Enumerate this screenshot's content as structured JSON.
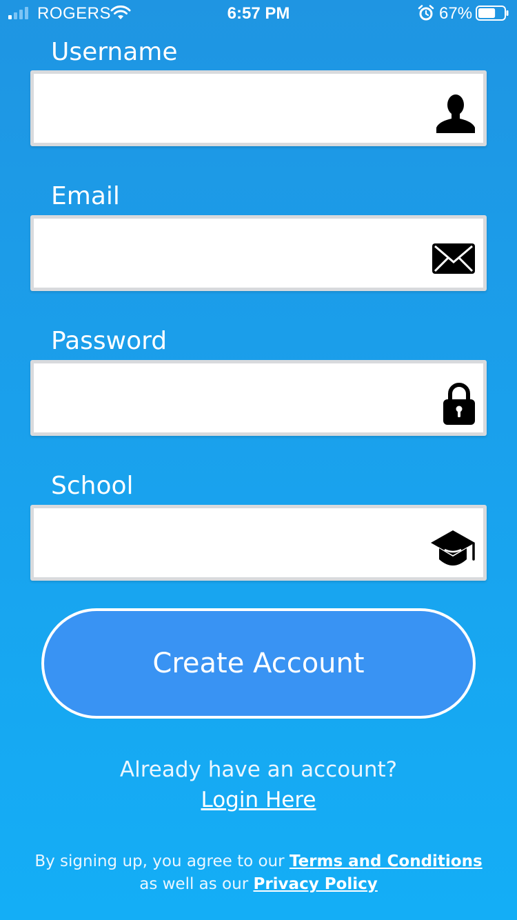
{
  "status_bar": {
    "carrier": "ROGERS",
    "time": "6:57 PM",
    "battery": "67%",
    "battery_level": 0.67
  },
  "form": {
    "username": {
      "label": "Username",
      "value": "",
      "placeholder": "",
      "icon": "user-icon"
    },
    "email": {
      "label": "Email",
      "value": "",
      "placeholder": "",
      "icon": "envelope-icon"
    },
    "password": {
      "label": "Password",
      "value": "",
      "placeholder": "",
      "icon": "lock-icon"
    },
    "school": {
      "label": "School",
      "value": "",
      "placeholder": "",
      "icon": "graduation-cap-icon"
    }
  },
  "create_button": {
    "label": "Create Account"
  },
  "login": {
    "prompt": "Already have an account?",
    "link": "Login Here"
  },
  "legal": {
    "line1_prefix": "By signing up, you agree to our ",
    "terms_link": "Terms and Conditions",
    "line2_prefix": "as well as our ",
    "privacy_link": "Privacy Policy"
  },
  "colors": {
    "background_top": "#1f95e2",
    "background_bottom": "#14aef6",
    "button_fill": "#3993f3",
    "field_border": "#d8dadd"
  }
}
